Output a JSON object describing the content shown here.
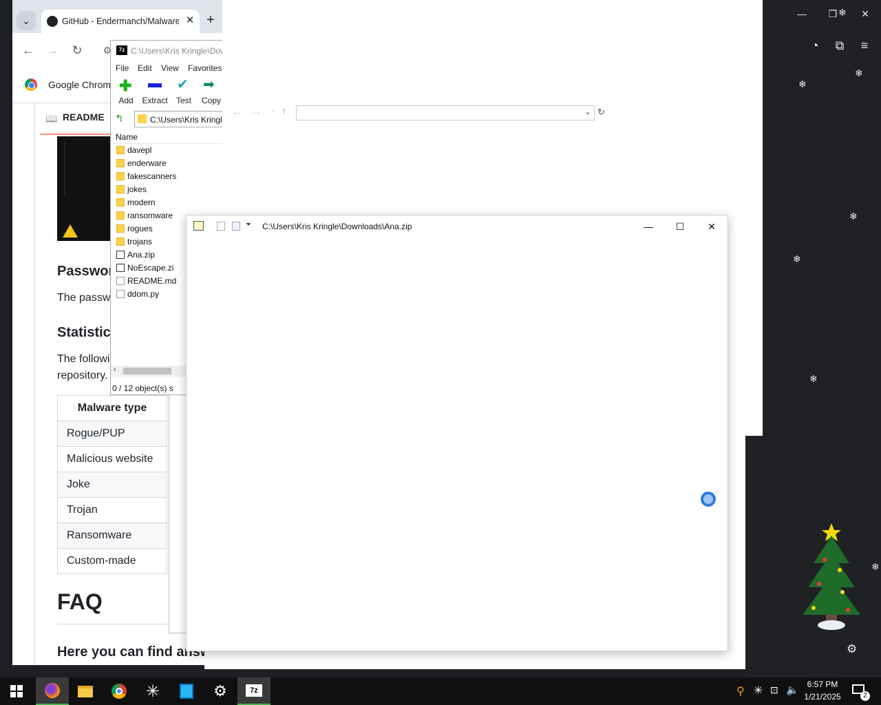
{
  "chrome": {
    "tab_title": "GitHub - Endermanch/Malware",
    "bookmark_label": "Google Chrome",
    "readme_tab": "README",
    "headings": {
      "password": "Passwor",
      "statistics": "Statistics",
      "faq": "FAQ"
    },
    "paragraphs": {
      "password": "The passw",
      "stats_1": "The followi",
      "stats_2": "repository.",
      "faq": "Here you can find answ"
    },
    "table": {
      "header": "Malware type",
      "rows": [
        "Rogue/PUP",
        "Malicious website",
        "Joke",
        "Trojan",
        "Ransomware",
        "Custom-made"
      ]
    }
  },
  "sevenzip": {
    "title": "C:\\Users\\Kris Kringle\\Dow",
    "menu": [
      "File",
      "Edit",
      "View",
      "Favorites"
    ],
    "toolbar": [
      "Add",
      "Extract",
      "Test",
      "Copy"
    ],
    "address": "C:\\Users\\Kris Kringle",
    "column_name": "Name",
    "files": [
      {
        "name": "davepl",
        "type": "folder"
      },
      {
        "name": "enderware",
        "type": "folder"
      },
      {
        "name": "fakescanners",
        "type": "folder"
      },
      {
        "name": "jokes",
        "type": "folder"
      },
      {
        "name": "modern",
        "type": "folder"
      },
      {
        "name": "ransomware",
        "type": "folder"
      },
      {
        "name": "rogues",
        "type": "folder"
      },
      {
        "name": "trojans",
        "type": "folder"
      },
      {
        "name": "Ana.zip",
        "type": "zip"
      },
      {
        "name": "NoEscape.zi",
        "type": "zip"
      },
      {
        "name": "README.md",
        "type": "file"
      },
      {
        "name": "ddom.py",
        "type": "file"
      }
    ],
    "status": "0 / 12 object(s) s"
  },
  "ana_window": {
    "title": "C:\\Users\\Kris Kringle\\Downloads\\Ana.zip"
  },
  "taskbar": {
    "time": "6:57 PM",
    "date": "1/21/2025",
    "notification_count": "2",
    "apps": [
      "start-icon",
      "firefox-icon",
      "file-explorer-icon",
      "chrome-icon",
      "sparkle-app-icon",
      "building-app-icon",
      "settings-icon",
      "7zip-icon"
    ]
  },
  "colors": {
    "accent": "#2f7be0",
    "desktop": "#202124",
    "taskbar": "#101010"
  }
}
